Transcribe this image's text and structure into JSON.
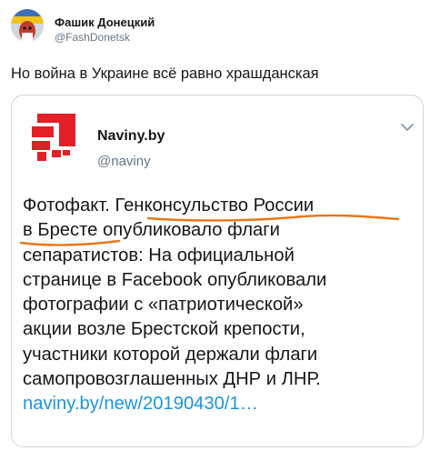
{
  "author": {
    "name": "Фашик Донецкий",
    "handle": "@FashDonetsk"
  },
  "tweet": {
    "text": "Но война в Украине всё равно храшданская"
  },
  "quoted": {
    "name": "Naviny.by",
    "handle": "@naviny",
    "lines": {
      "l1a": "Фотофакт. ",
      "l1b": "Генконсульство России",
      "l2a": "в Бресте",
      "l2b": " опубликовало флаги",
      "l3": "сепаратистов: На официальной",
      "l4": "странице в Facebook опубликовали",
      "l5": "фотографии с «патриотической»",
      "l6": "акции возле Брестской крепости,",
      "l7": "участники которой держали флаги",
      "l8": "самопровозглашенных ДНР и ЛНР.",
      "link": "naviny.by/new/20190430/1…"
    }
  },
  "colors": {
    "link": "#1b95e0",
    "logo_red": "#e41e26",
    "underline": "#e8771a"
  },
  "icons": {
    "chevron": "chevron-down-icon",
    "logo": "naviny-logo"
  }
}
